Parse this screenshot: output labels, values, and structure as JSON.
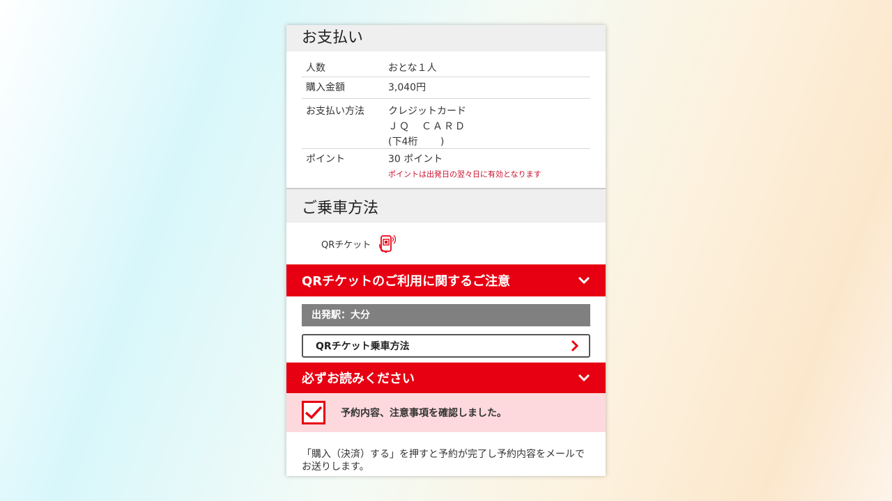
{
  "payment": {
    "title": "お支払い",
    "rows": [
      {
        "label": "人数",
        "value": "おとな１人"
      },
      {
        "label": "購入金額",
        "value": "3,040円"
      },
      {
        "label": "お支払い方法",
        "value_lines": [
          "クレジットカード",
          "ＪＱ　ＣＡＲＤ",
          "(下4桁　　 )"
        ]
      },
      {
        "label": "ポイント",
        "value": "30 ポイント",
        "note": "ポイントは出発日の翌々日に有効となります"
      }
    ]
  },
  "boarding": {
    "title": "ご乗車方法",
    "method_label": "QRチケット",
    "method_icon": "qr-phone-icon"
  },
  "qr_notice": {
    "title": "QRチケットのご利用に関するご注意",
    "departure": "出発駅：大分",
    "how_to_button": "QRチケット乗車方法"
  },
  "must_read": {
    "title": "必ずお読みください",
    "confirm_label": "予約内容、注意事項を確認しました。",
    "checked": true
  },
  "footer": {
    "text": "「購入（決済）する」を押すと予約が完了し予約内容をメールでお送りします。"
  },
  "colors": {
    "accent": "#e60012",
    "note": "#c8102e",
    "confirm_bg": "#fdd9de",
    "gray_bar": "#808080"
  }
}
